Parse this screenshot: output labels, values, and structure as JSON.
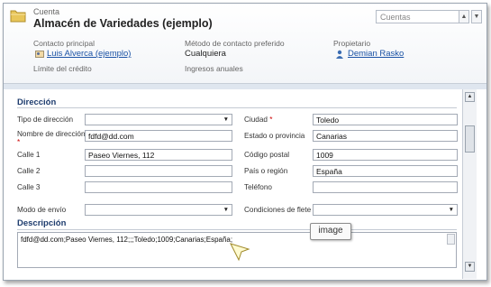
{
  "header": {
    "entity_type": "Cuenta",
    "record_name": "Almacén de Variedades (ejemplo)",
    "form_selector": "Cuentas",
    "fields": {
      "primary_contact_label": "Contacto principal",
      "primary_contact_value": "Luis Alverca (ejemplo)",
      "contact_method_label": "Método de contacto preferido",
      "contact_method_value": "Cualquiera",
      "owner_label": "Propietario",
      "owner_value": "Demian Rasko",
      "credit_limit_label": "Límite del crédito",
      "annual_revenue_label": "Ingresos anuales"
    }
  },
  "address": {
    "section_title": "Dirección",
    "address_type_label": "Tipo de dirección",
    "address_type_value": "",
    "address_name_label": "Nombre de dirección",
    "address_name_value": "fdfd@dd.com",
    "street1_label": "Calle 1",
    "street1_value": "Paseo Viernes, 112",
    "street2_label": "Calle 2",
    "street2_value": "",
    "street3_label": "Calle 3",
    "street3_value": "",
    "city_label": "Ciudad",
    "city_value": "Toledo",
    "state_label": "Estado o provincia",
    "state_value": "Canarias",
    "postal_label": "Código postal",
    "postal_value": "1009",
    "country_label": "País o región",
    "country_value": "España",
    "phone_label": "Teléfono",
    "phone_value": "",
    "shipping_label": "Modo de envío",
    "shipping_value": "",
    "freight_label": "Condiciones de flete",
    "freight_value": "",
    "required_marker": "*"
  },
  "description": {
    "section_title": "Descripción",
    "value": "fdfd@dd.com;Paseo Viernes, 112;;;Toledo;1009;Canarias;España;"
  },
  "tooltip": "image",
  "colors": {
    "link": "#1a52a5",
    "section_title": "#1e3c6e",
    "required": "#cc0000"
  }
}
